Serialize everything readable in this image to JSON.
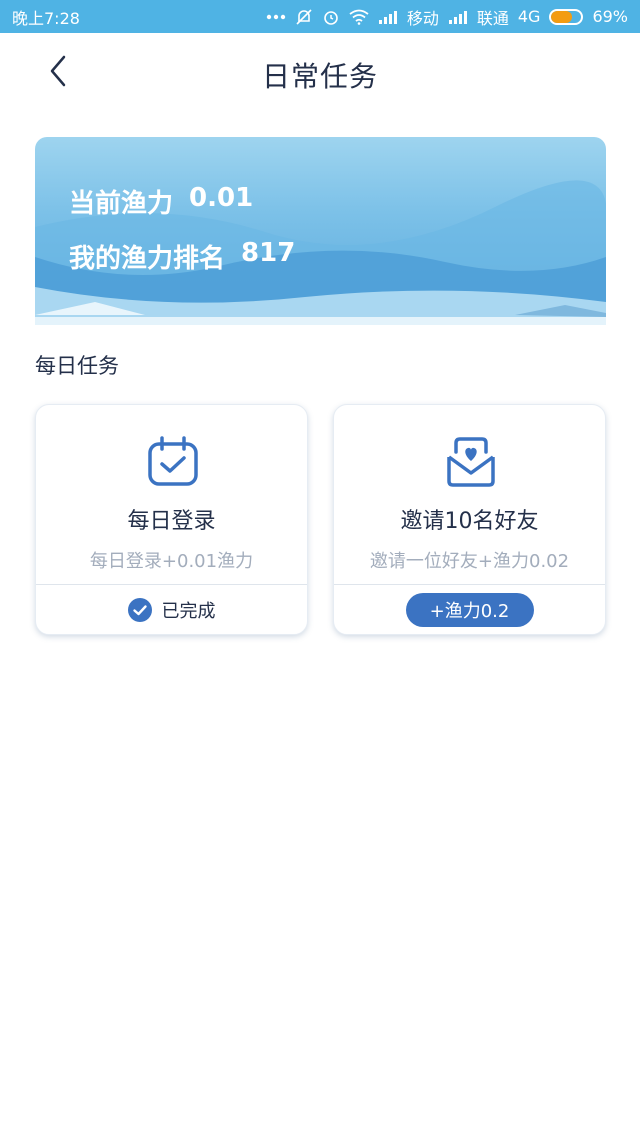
{
  "status_bar": {
    "time": "晚上7:28",
    "carrier1": "移动",
    "carrier2": "联通",
    "network": "4G",
    "battery": "69%",
    "battery_level": 0.69,
    "battery_color": "#f39c12"
  },
  "header": {
    "title": "日常任务",
    "back_icon": "chevron-left-icon"
  },
  "banner": {
    "current_label": "当前渔力",
    "current_value": "0.01",
    "rank_label": "我的渔力排名",
    "rank_value": "817"
  },
  "section": {
    "title": "每日任务"
  },
  "tasks": [
    {
      "icon": "calendar-check-icon",
      "title": "每日登录",
      "desc": "每日登录+0.01渔力",
      "status": "已完成"
    },
    {
      "icon": "heart-envelope-icon",
      "title": "邀请10名好友",
      "desc": "邀请一位好友+渔力0.02",
      "button": "+渔力0.2"
    }
  ],
  "colors": {
    "status_bar": "#4fb3e4",
    "accent": "#3b73c2",
    "title_text": "#24304a",
    "muted_text": "#a3adbc"
  }
}
